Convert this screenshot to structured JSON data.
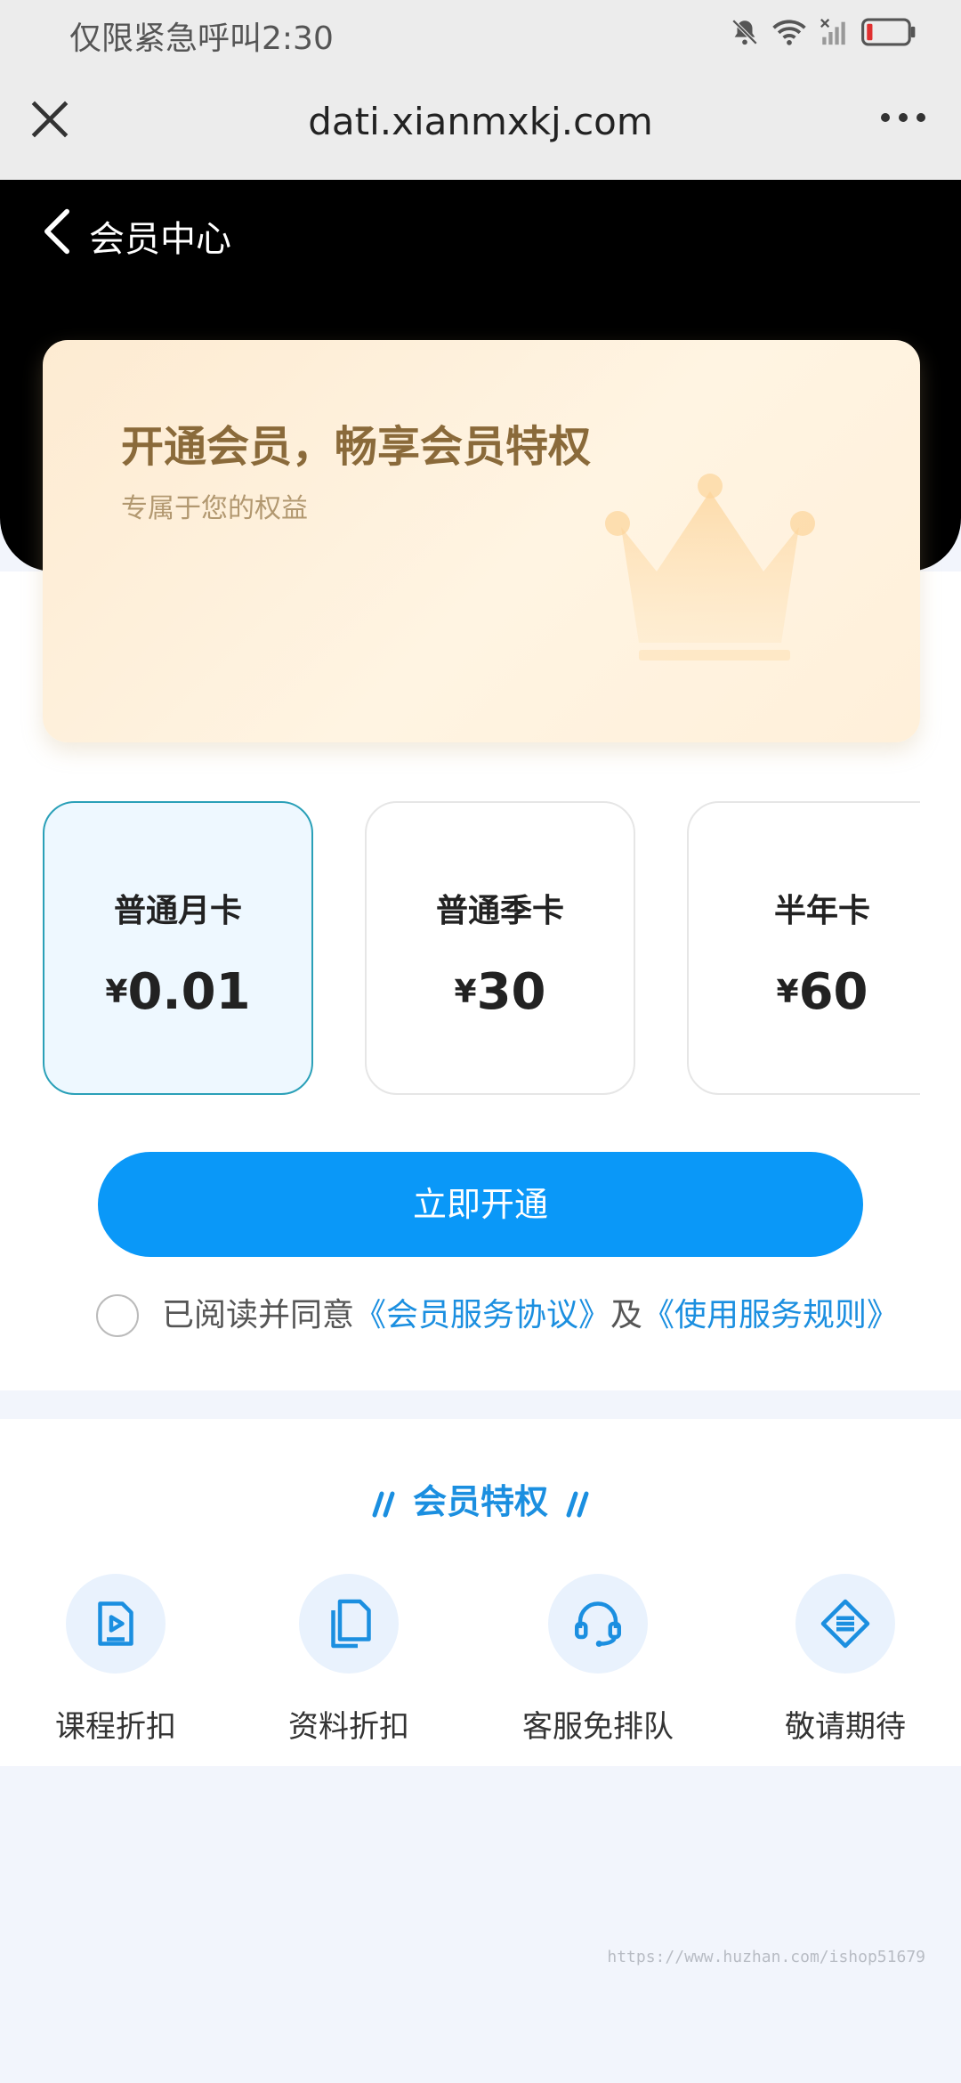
{
  "status_bar": {
    "carrier_text": "仅限紧急呼叫",
    "time": "2:30",
    "icons": [
      "bell-muted-icon",
      "wifi-icon",
      "signal-off-icon",
      "battery-low-icon"
    ]
  },
  "browser": {
    "url": "dati.xianmxkj.com",
    "close_icon": "close-icon",
    "more_icon": "more-dots-icon"
  },
  "header": {
    "title": "会员中心"
  },
  "member_card": {
    "title": "开通会员，畅享会员特权",
    "subtitle": "专属于您的权益",
    "icon": "crown-icon"
  },
  "plans": [
    {
      "name": "普通月卡",
      "currency": "¥",
      "price": "0.01",
      "selected": true
    },
    {
      "name": "普通季卡",
      "currency": "¥",
      "price": "30",
      "selected": false
    },
    {
      "name": "半年卡",
      "currency": "¥",
      "price": "60",
      "selected": false
    }
  ],
  "cta": {
    "label": "立即开通"
  },
  "agreement": {
    "prefix": "已阅读并同意",
    "link1": "《会员服务协议》",
    "conj": "及",
    "link2": "《使用服务规则》"
  },
  "privileges": {
    "title": "会员特权",
    "items": [
      {
        "label": "课程折扣",
        "icon": "video-course-icon"
      },
      {
        "label": "资料折扣",
        "icon": "document-icon"
      },
      {
        "label": "客服免排队",
        "icon": "headset-icon"
      },
      {
        "label": "敬请期待",
        "icon": "list-diamond-icon"
      }
    ]
  },
  "colors": {
    "accent": "#0a98f8",
    "link": "#1b8fe0",
    "gold_title": "#8a6a3a",
    "selected_border": "#2aa0b8"
  },
  "watermark": "https://www.huzhan.com/ishop51679"
}
